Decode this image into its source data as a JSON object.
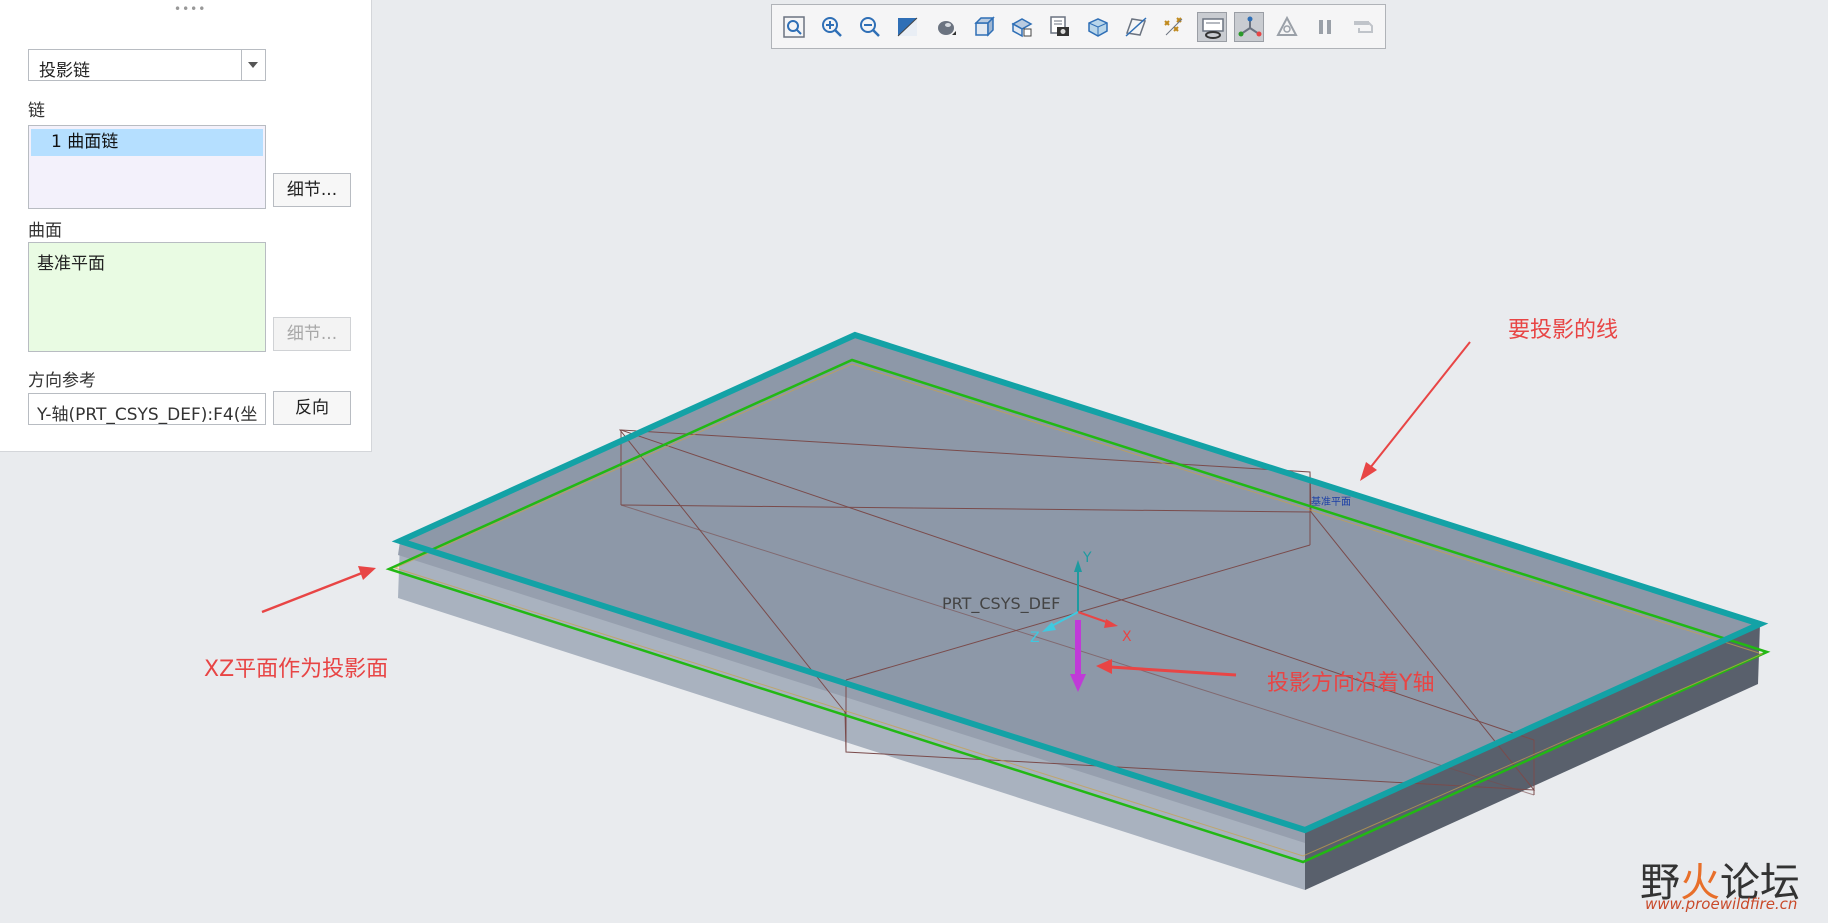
{
  "panel": {
    "type_select": "投影链",
    "chain_label": "链",
    "chain_items": [
      "1 曲面链"
    ],
    "chain_detail_button": "细节...",
    "surface_label": "曲面",
    "surface_value": "基准平面",
    "surface_detail_button": "细节...",
    "direction_label": "方向参考",
    "direction_value": "Y-轴(PRT_CSYS_DEF):F4(坐",
    "flip_button": "反向"
  },
  "toolbar": {
    "icons": [
      "refit-icon",
      "zoom-in-icon",
      "zoom-out-icon",
      "repaint-icon",
      "display-style-icon",
      "saved-views-icon",
      "view-manager-icon",
      "annotation-display-icon",
      "perspective-icon",
      "datum-display-icon",
      "point-display-icon",
      "spin-center-icon",
      "csys-display-icon",
      "appearance-icon",
      "pause-icon",
      "orient-icon"
    ],
    "active": [
      "spin-center-icon",
      "csys-display-icon"
    ]
  },
  "viewport": {
    "csys_label": "PRT_CSYS_DEF",
    "axis_y": "Y",
    "axis_x": "X",
    "axis_z": "Z",
    "plane_tag": "基准平面"
  },
  "annotations": {
    "line_to_project": "要投影的线",
    "projection_surface": "XZ平面作为投影面",
    "direction_along_y": "投影方向沿着Y轴"
  },
  "watermark": {
    "logo_a": "野",
    "logo_fire": "火",
    "logo_b": "论坛",
    "url": "www.proewildfire.cn"
  },
  "colors": {
    "top_edge": "#13a2a6",
    "projected_line": "#22b814",
    "annotation": "#e84545",
    "y_arrow": "#c03ad8"
  }
}
